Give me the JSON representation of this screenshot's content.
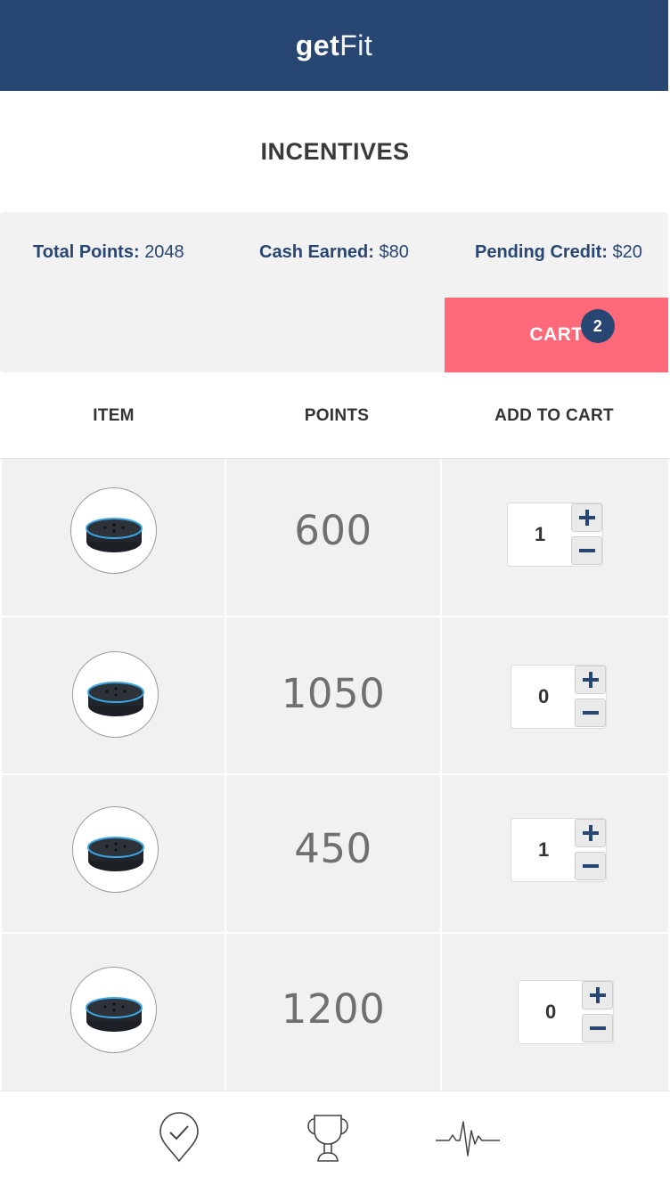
{
  "header": {
    "logo_bold": "get",
    "logo_light": "Fit",
    "bg_color": "#284672"
  },
  "page": {
    "title": "INCENTIVES"
  },
  "stats": {
    "total_points_label": "Total Points:",
    "total_points_value": "2048",
    "cash_earned_label": "Cash Earned:",
    "cash_earned_value": "$80",
    "pending_credit_label": "Pending Credit:",
    "pending_credit_value": "$20"
  },
  "cart": {
    "label": "CART",
    "count": "2",
    "color": "#fe6a7a"
  },
  "table": {
    "headers": [
      "ITEM",
      "POINTS",
      "ADD TO CART"
    ],
    "rows": [
      {
        "item_icon": "smart-speaker-image",
        "points": "600",
        "qty": "1"
      },
      {
        "item_icon": "smart-speaker-image",
        "points": "1050",
        "qty": "0"
      },
      {
        "item_icon": "smart-speaker-image",
        "points": "450",
        "qty": "1"
      },
      {
        "item_icon": "smart-speaker-image",
        "points": "1200",
        "qty": "0"
      }
    ]
  },
  "nav": {
    "items": [
      {
        "icon": "location-check-icon"
      },
      {
        "icon": "trophy-icon"
      },
      {
        "icon": "heartbeat-icon"
      }
    ]
  }
}
